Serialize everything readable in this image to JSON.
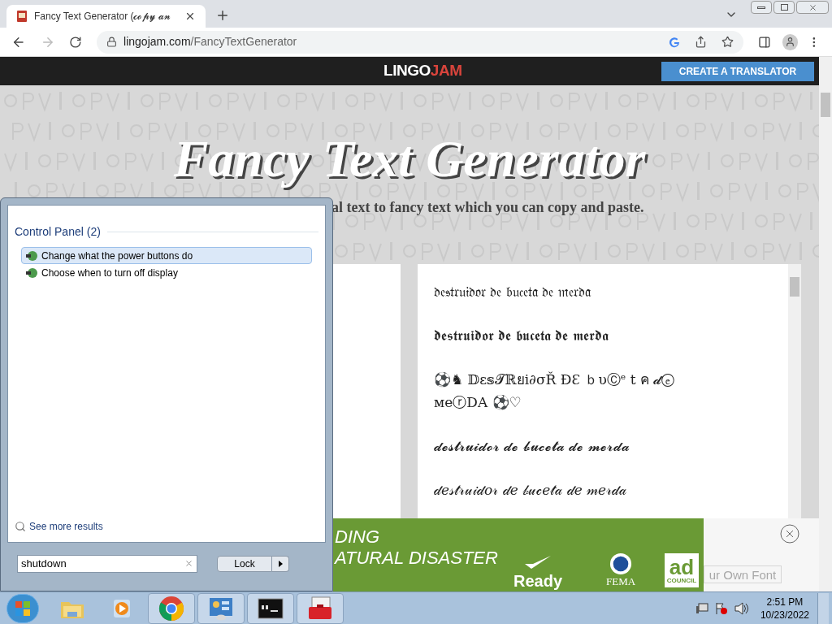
{
  "browser": {
    "tab": {
      "title": "Fancy Text Generator (𝓬𝓸𝓹𝔂 𝓪𝓷"
    },
    "url": {
      "host": "lingojam.com",
      "path": "/FancyTextGenerator"
    }
  },
  "site": {
    "logo": {
      "first": "LINGO",
      "second": "JAM"
    },
    "cta": "CREATE A TRANSLATOR",
    "title": "Fancy Text Generator",
    "subtitle": "al text to fancy text which you can copy and paste.",
    "outputs": [
      "𝔡𝔢𝔰𝔱𝔯𝔲𝔦𝔡𝔬𝔯 𝔡𝔢 𝔟𝔲𝔠𝔢𝔱𝔞 𝔡𝔢 𝔪𝔢𝔯𝔡𝔞",
      "𝖉𝖊𝖘𝖙𝖗𝖚𝖎𝖉𝖔𝖗 𝖉𝖊 𝖇𝖚𝖈𝖊𝖙𝖆 𝖉𝖊 𝖒𝖊𝖗𝖉𝖆",
      "⚽♞ 𝔻ɛ𝕤𝓣ℝยi∂σŘ ĐƐ ｂυⒸᵉ t ค 𝓭ⓔ ᴍeⓡDΑ ⚽♡",
      "𝓭𝓮𝓼𝓽𝓻𝓾𝓲𝓭𝓸𝓻 𝓭𝓮 𝓫𝓾𝓬𝓮𝓽𝓪 𝓭𝓮 𝓶𝓮𝓻𝓭𝓪",
      "𝒹𝑒𝓈𝓉𝓇𝓊𝒾𝒹𝑜𝓇 𝒹𝑒 𝒷𝓊𝒸𝑒𝓉𝒶 𝒹𝑒 𝓂𝑒𝓇𝒹𝒶"
    ],
    "faded_button": "ur Own Font"
  },
  "ad": {
    "lines": [
      "DING",
      "ATURAL DISASTER"
    ],
    "ready": "Ready",
    "fema": "FEMA",
    "council": {
      "big": "ad",
      "small": "COUNCIL"
    }
  },
  "start_menu": {
    "group_title": "Control Panel (2)",
    "items": [
      {
        "label": "Change what the power buttons do",
        "selected": true
      },
      {
        "label": "Choose when to turn off display",
        "selected": false
      }
    ],
    "see_more": "See more results",
    "search": {
      "value": "shutdown"
    },
    "power_button": "Lock"
  },
  "taskbar": {
    "apps": [
      {
        "kind": "explorer",
        "running": false
      },
      {
        "kind": "media",
        "running": false
      },
      {
        "kind": "chrome",
        "running": true
      },
      {
        "kind": "control",
        "running": true
      },
      {
        "kind": "console",
        "running": true
      },
      {
        "kind": "toolbox",
        "running": true
      }
    ],
    "clock": {
      "time": "2:51 PM",
      "date": "10/23/2022"
    }
  }
}
